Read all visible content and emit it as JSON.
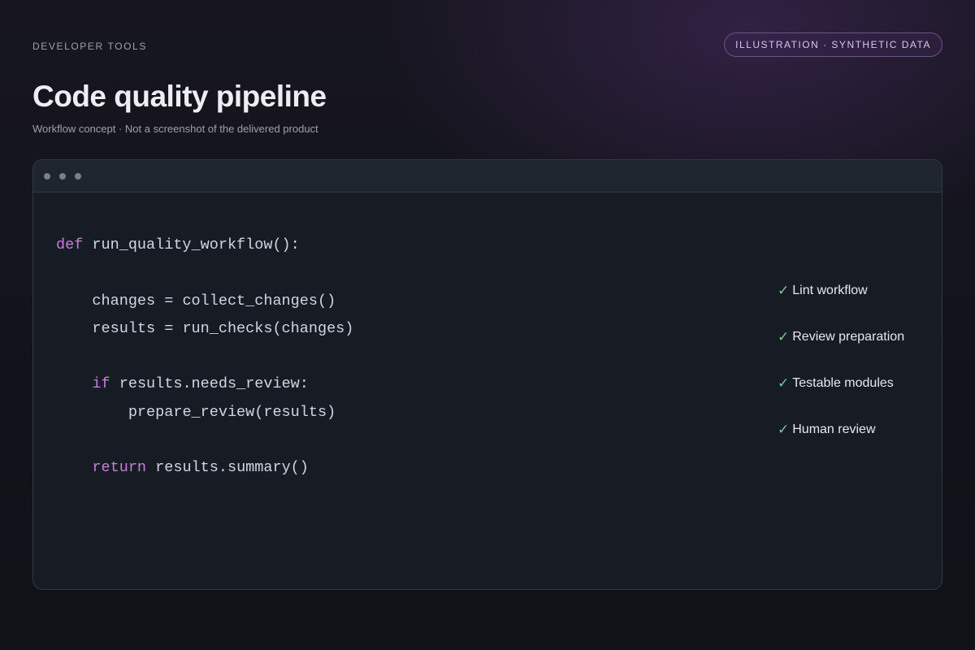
{
  "header": {
    "eyebrow": "DEVELOPER TOOLS",
    "badge": "ILLUSTRATION · SYNTHETIC DATA",
    "title": "Code quality pipeline",
    "subtitle": "Workflow concept · Not a screenshot of the delivered product"
  },
  "editor": {
    "code_lines": [
      {
        "indent": "",
        "keyword": "def",
        "rest": " run_quality_workflow():"
      },
      {
        "indent": "",
        "keyword": "",
        "rest": ""
      },
      {
        "indent": "    ",
        "keyword": "",
        "rest": "changes = collect_changes()"
      },
      {
        "indent": "    ",
        "keyword": "",
        "rest": "results = run_checks(changes)"
      },
      {
        "indent": "",
        "keyword": "",
        "rest": ""
      },
      {
        "indent": "    ",
        "keyword": "if",
        "rest": " results.needs_review:"
      },
      {
        "indent": "        ",
        "keyword": "",
        "rest": "prepare_review(results)"
      },
      {
        "indent": "",
        "keyword": "",
        "rest": ""
      },
      {
        "indent": "    ",
        "keyword": "return",
        "rest": " results.summary()"
      }
    ],
    "checklist": [
      {
        "icon": "check-icon",
        "label": "Lint workflow"
      },
      {
        "icon": "check-icon",
        "label": "Review preparation"
      },
      {
        "icon": "check-icon",
        "label": "Testable modules"
      },
      {
        "icon": "check-icon",
        "label": "Human review"
      }
    ]
  },
  "colors": {
    "keyword": "#c77ddc",
    "check": "#79c98f",
    "badge_border": "#6b5585"
  }
}
